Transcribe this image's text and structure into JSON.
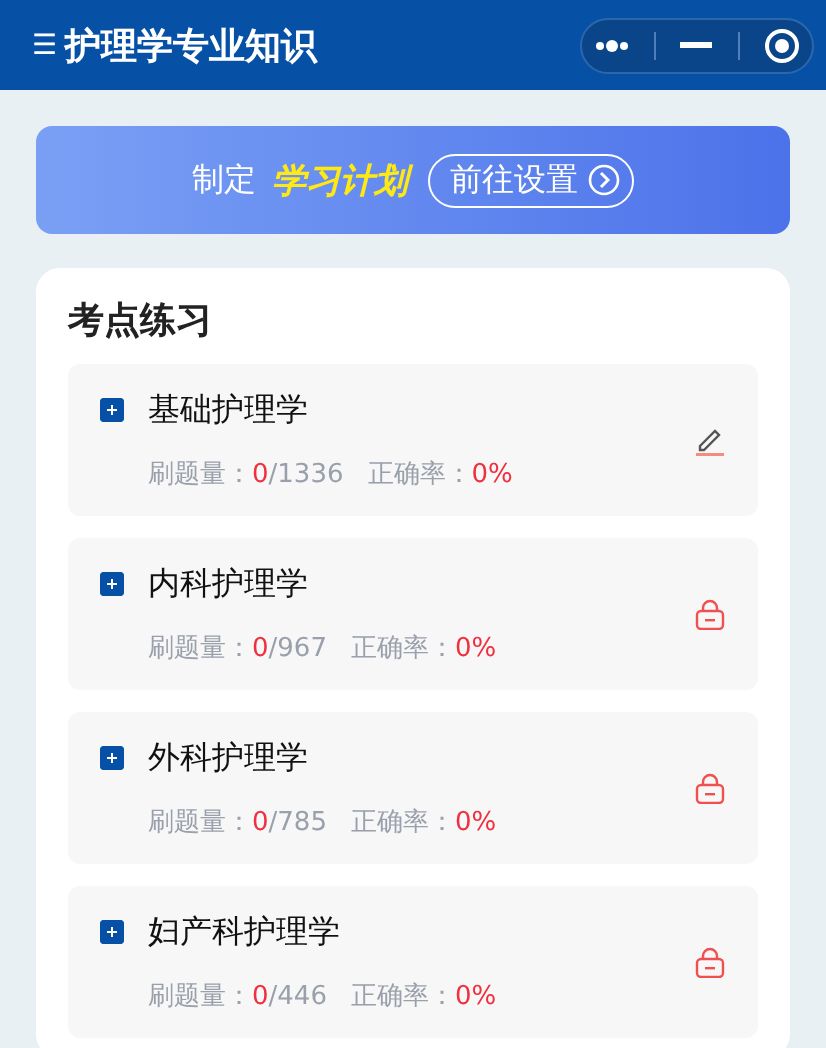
{
  "header": {
    "menu_icon": "☰",
    "title": "护理学专业知识"
  },
  "banner": {
    "prefix": "制定",
    "highlight": "学习计划",
    "button": "前往设置"
  },
  "section": {
    "title": "考点练习",
    "items": [
      {
        "name": "基础护理学",
        "count_label": "刷题量：",
        "done": "0",
        "total": "/1336",
        "rate_label": "正确率：",
        "rate": "0%",
        "locked": false
      },
      {
        "name": "内科护理学",
        "count_label": "刷题量：",
        "done": "0",
        "total": "/967",
        "rate_label": "正确率：",
        "rate": "0%",
        "locked": true
      },
      {
        "name": "外科护理学",
        "count_label": "刷题量：",
        "done": "0",
        "total": "/785",
        "rate_label": "正确率：",
        "rate": "0%",
        "locked": true
      },
      {
        "name": "妇产科护理学",
        "count_label": "刷题量：",
        "done": "0",
        "total": "/446",
        "rate_label": "正确率：",
        "rate": "0%",
        "locked": true
      }
    ]
  }
}
